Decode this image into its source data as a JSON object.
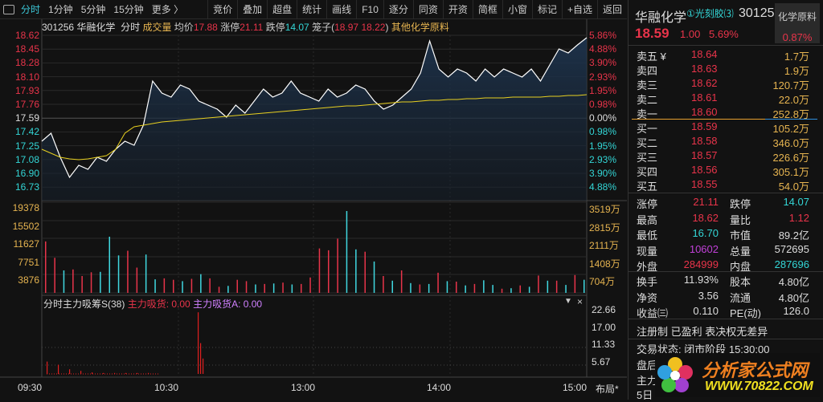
{
  "toolbar": {
    "tabs": [
      "分时",
      "1分钟",
      "5分钟",
      "15分钟",
      "更多 〉"
    ],
    "buttons": [
      "竞价",
      "叠加",
      "超盘",
      "统计",
      "画线",
      "F10",
      "逐分",
      "同资",
      "开资",
      "简框",
      "小窗",
      "标记",
      "+自选",
      "返回"
    ]
  },
  "info": {
    "code": "301256",
    "name": "华融化学",
    "mode": "分时",
    "vol_label": "成交量",
    "avg_label": "均价",
    "avg": "17.88",
    "up_label": "涨停",
    "up": "21.11",
    "down_label": "跌停",
    "down": "14.07",
    "lz_label": "笼子(",
    "lz1": "18.97",
    "lz2": "18.22",
    "lz_end": ")",
    "sector": "其他化学原料"
  },
  "axes": {
    "price_left": [
      "18.62",
      "18.45",
      "18.28",
      "18.10",
      "17.93",
      "17.76",
      "17.59",
      "17.42",
      "17.25",
      "17.08",
      "16.90",
      "16.73"
    ],
    "pct_right": [
      "5.86%",
      "4.88%",
      "3.90%",
      "2.93%",
      "1.95%",
      "0.98%",
      "0.00%",
      "0.98%",
      "1.95%",
      "2.93%",
      "3.90%",
      "4.88%"
    ],
    "vol_left": [
      "19378",
      "15502",
      "11627",
      "7751",
      "3876"
    ],
    "vol_right": [
      "3519万",
      "2815万",
      "2111万",
      "1408万",
      "704万"
    ],
    "ind_right": [
      "22.66",
      "17.00",
      "11.33",
      "5.67"
    ],
    "time": [
      "09:30",
      "10:30",
      "13:00",
      "14:00",
      "15:00"
    ],
    "layout_btn": "布局*"
  },
  "indicator": {
    "name": "分时主力吸筹S(38)",
    "a_label": "主力吸货: 0.00",
    "b_label": "主力吸货A: 0.00"
  },
  "chart_data": {
    "type": "line",
    "prev_close": 17.59,
    "ylim": [
      16.73,
      18.62
    ],
    "price": [
      17.3,
      17.4,
      17.1,
      16.85,
      17.0,
      16.95,
      17.1,
      17.05,
      17.2,
      17.3,
      17.25,
      17.5,
      18.05,
      17.9,
      17.85,
      18.0,
      17.95,
      17.8,
      17.75,
      17.7,
      17.6,
      17.75,
      17.65,
      17.8,
      17.95,
      17.85,
      17.9,
      18.05,
      17.9,
      17.85,
      17.8,
      17.95,
      17.85,
      17.9,
      18.0,
      17.95,
      17.8,
      17.7,
      17.75,
      17.85,
      17.95,
      18.15,
      18.55,
      18.2,
      18.1,
      18.2,
      18.15,
      18.05,
      18.2,
      18.1,
      18.2,
      18.15,
      18.1,
      18.2,
      18.05,
      18.25,
      18.45,
      18.4,
      18.5,
      18.59
    ],
    "avg": [
      17.2,
      17.15,
      17.1,
      17.08,
      17.07,
      17.08,
      17.1,
      17.12,
      17.2,
      17.4,
      17.48,
      17.5,
      17.52,
      17.54,
      17.55,
      17.56,
      17.57,
      17.58,
      17.59,
      17.6,
      17.61,
      17.62,
      17.63,
      17.64,
      17.65,
      17.66,
      17.67,
      17.68,
      17.69,
      17.7,
      17.71,
      17.72,
      17.73,
      17.74,
      17.74,
      17.75,
      17.76,
      17.77,
      17.78,
      17.79,
      17.79,
      17.8,
      17.81,
      17.81,
      17.82,
      17.82,
      17.83,
      17.83,
      17.84,
      17.84,
      17.84,
      17.85,
      17.85,
      17.85,
      17.85,
      17.86,
      17.86,
      17.87,
      17.87,
      17.88
    ],
    "volume": [
      11000,
      7500,
      4800,
      5000,
      3600,
      4400,
      4500,
      12000,
      8000,
      9000,
      5400,
      8200,
      2900,
      3100,
      2800,
      2500,
      3000,
      4000,
      3100,
      1300,
      1500,
      2800,
      2500,
      1800,
      1900,
      2000,
      2200,
      1800,
      1900,
      3300,
      9500,
      9100,
      11600,
      17500,
      9300,
      8800,
      6700,
      3600,
      2600,
      4800,
      2100,
      1800,
      1900,
      4300,
      2500,
      2400,
      1600,
      1900,
      2700,
      1700,
      900,
      1000,
      1600,
      1300,
      3700,
      2600,
      2600,
      1700,
      3800,
      2800
    ],
    "volume_colors": "rrcrrrcccrrccrrcrcrrcrrcrcrcrrrrrccrcrcrcrcrcrcrccrcrcrcrcr",
    "indicator": [
      4,
      3,
      1.5,
      1,
      0.5,
      0.3,
      0.3,
      0.3,
      0.3,
      0.3,
      20,
      10,
      5
    ]
  },
  "quote": {
    "name": "华融化学",
    "tag": "①光刻胶⑶",
    "code": "30125",
    "sector": "化学原料",
    "price": "18.59",
    "chg": "1.00",
    "pct": "5.69%",
    "sector_pct": "0.87%"
  },
  "book": {
    "sell": [
      [
        "卖五 ¥",
        "18.64",
        "1.7万"
      ],
      [
        "卖四",
        "18.63",
        "1.9万"
      ],
      [
        "卖三",
        "18.62",
        "120.7万"
      ],
      [
        "卖二",
        "18.61",
        "22.0万"
      ],
      [
        "卖一",
        "18.60",
        "252.8万"
      ]
    ],
    "buy": [
      [
        "买一",
        "18.59",
        "105.2万"
      ],
      [
        "买二",
        "18.58",
        "346.0万"
      ],
      [
        "买三",
        "18.57",
        "226.6万"
      ],
      [
        "买四",
        "18.56",
        "305.1万"
      ],
      [
        "买五",
        "18.55",
        "54.0万"
      ]
    ]
  },
  "stats": [
    [
      "涨停",
      "21.11",
      "跌停",
      "14.07"
    ],
    [
      "最高",
      "18.62",
      "量比",
      "1.12"
    ],
    [
      "最低",
      "16.70",
      "市值",
      "89.2亿"
    ],
    [
      "现量",
      "10602",
      "总量",
      "572695"
    ],
    [
      "外盘",
      "284999",
      "内盘",
      "287696"
    ],
    [
      "换手",
      "11.93%",
      "股本",
      "4.80亿"
    ],
    [
      "净资",
      "3.56",
      "流通",
      "4.80亿"
    ],
    [
      "收益㈢",
      "0.110",
      "PE(动)",
      "126.0"
    ]
  ],
  "notes": {
    "flags": "注册制 已盈利 表决权无差异",
    "status": "交易状态: 闭市阶段 15:30:00",
    "l1": "盘后",
    "l2": "主力",
    "l3": "5日"
  },
  "logo": {
    "cn": "分析家公式网",
    "url": "WWW.70822.COM"
  }
}
